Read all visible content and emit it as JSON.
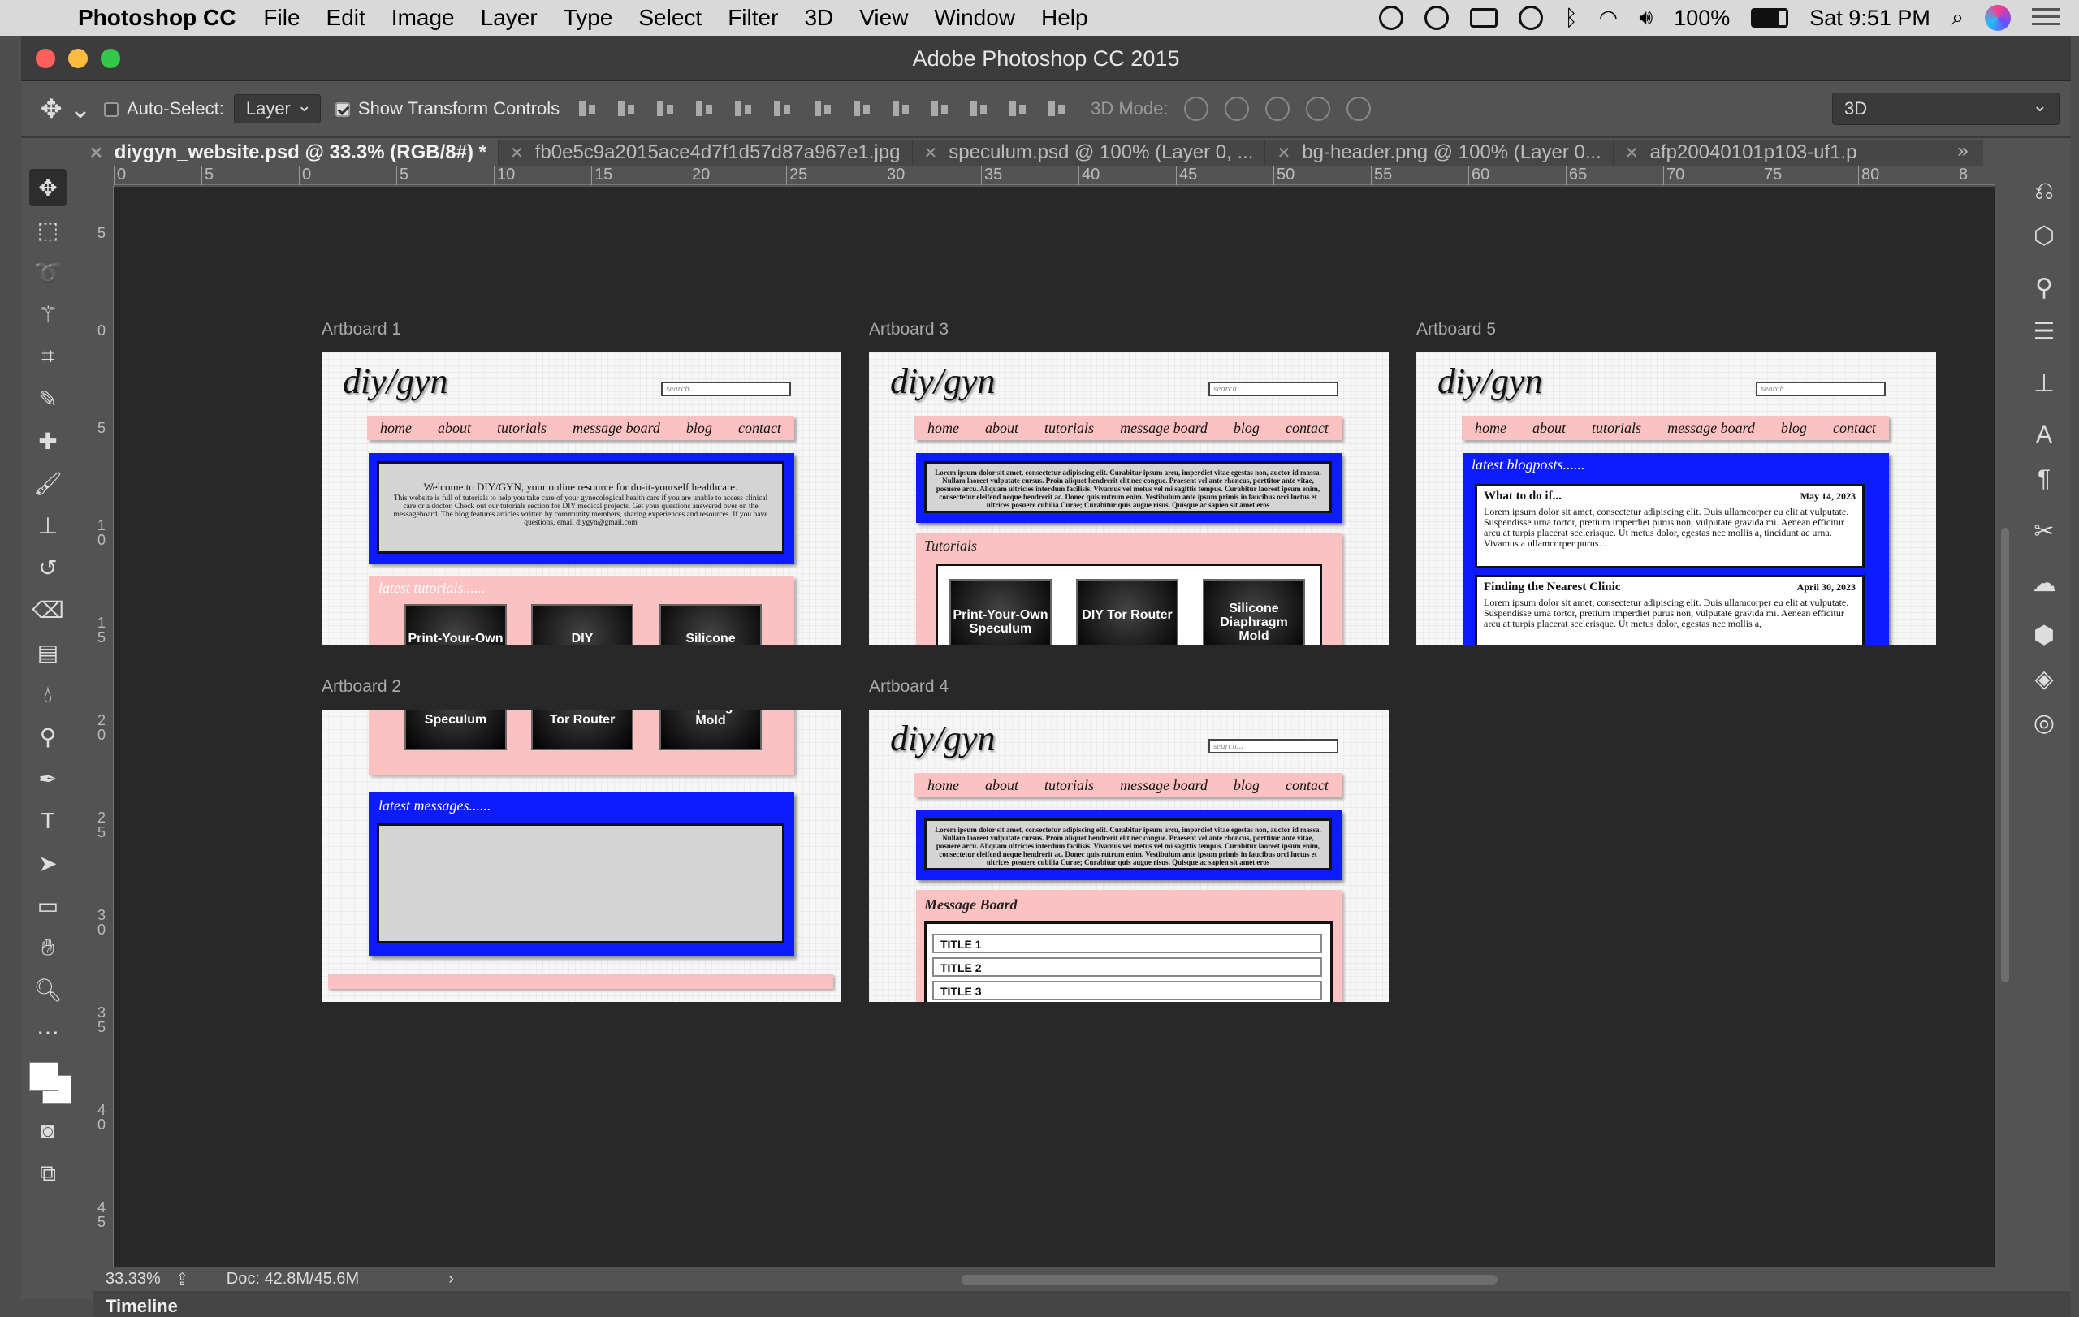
{
  "menubar": {
    "app": "Photoshop CC",
    "items": [
      "File",
      "Edit",
      "Image",
      "Layer",
      "Type",
      "Select",
      "Filter",
      "3D",
      "View",
      "Window",
      "Help"
    ],
    "battery": "100%",
    "clock": "Sat 9:51 PM"
  },
  "window": {
    "title": "Adobe Photoshop CC 2015"
  },
  "options": {
    "auto_select_label": "Auto-Select:",
    "auto_select_value": "Layer",
    "transform_label": "Show Transform Controls",
    "mode3d_label": "3D Mode:",
    "workspace": "3D"
  },
  "tabs": [
    {
      "label": "diygyn_website.psd @ 33.3% (RGB/8#) *"
    },
    {
      "label": "fb0e5c9a2015ace4d7f1d57d87a967e1.jpg"
    },
    {
      "label": "speculum.psd @ 100% (Layer 0, ..."
    },
    {
      "label": "bg-header.png @ 100% (Layer 0..."
    },
    {
      "label": "afp20040101p103-uf1.p"
    }
  ],
  "ruler_h": [
    "0",
    "5",
    "0",
    "5",
    "10",
    "15",
    "20",
    "25",
    "30",
    "35",
    "40",
    "45",
    "50",
    "55",
    "60",
    "65",
    "70",
    "75",
    "80",
    "8"
  ],
  "ruler_v": [
    "5",
    "0",
    "5",
    "10",
    "15",
    "20",
    "25",
    "30",
    "35",
    "40",
    "45"
  ],
  "status": {
    "zoom": "33.33%",
    "doc": "Doc: 42.8M/45.6M"
  },
  "timeline": "Timeline",
  "site": {
    "logo": "diy/gyn",
    "search": "search...",
    "nav": [
      "home",
      "about",
      "tutorials",
      "message board",
      "blog",
      "contact"
    ],
    "welcome_line1": "Welcome to DIY/GYN, your online resource for do-it-yourself healthcare.",
    "welcome_body": "This website is full of tutorials to help you take care of your gynecological health care if you are unable to access clinical care or a doctor. Check out our tutorials section for DIY medical projects. Get your questions answered over on the messageboard. The blog features articles written by community members, sharing experiences and resources. If you have questions, email diygyn@gmail.com",
    "latest_tutorials": "latest tutorials......",
    "tutorials_title": "Tutorials",
    "tutorial1": "Print-Your-Own Speculum",
    "tutorial2": "DIY Tor Router",
    "tutorial3": "Silicone Diaphragm Mold",
    "t1_top": "Print-Your-Own",
    "t2_top": "DIY",
    "t3_top": "Silicone",
    "t1_bottom": "Speculum",
    "t2_bottom": "Tor Router",
    "t3_bottom": "Diaphragm Mold",
    "lorem_block": "Lorem ipsum dolor sit amet, consectetur adipiscing elit. Curabitur ipsum arcu, imperdiet vitae egestas non, auctor id massa. Nullam laoreet vulputate cursus. Proin aliquet hendrerit elit nec congue. Praesent vel ante rhoncus, porttitor ante vitae, posuere arcu. Aliquam ultricies interdum facilisis. Vivamus vel metus vel mi sagittis tempus. Curabitur laoreet ipsum enim, consectetur eleifend neque hendrerit ac. Donec quis rutrum enim. Vestibulum ante ipsum primis in faucibus orci luctus et ultrices posuere cubilia Curae; Curabitur quis augue risus. Quisque ac sapien sit amet eros",
    "latest_blogposts": "latest blogposts......",
    "post1_title": "What to do if...",
    "post1_date": "May 14, 2023",
    "post1_body": "Lorem ipsum dolor sit amet, consectetur adipiscing elit. Duis ullamcorper eu elit at vulputate. Suspendisse urna tortor, pretium imperdiet purus non, vulputate gravida mi. Aenean efficitur arcu at turpis placerat scelerisque. Ut metus dolor, egestas nec mollis a, tincidunt ac urna. Vivamus a ullamcorper purus...",
    "post2_title": "Finding the Nearest Clinic",
    "post2_date": "April 30, 2023",
    "post2_body": "Lorem ipsum dolor sit amet, consectetur adipiscing elit. Duis ullamcorper eu elit at vulputate. Suspendisse urna tortor, pretium imperdiet purus non, vulputate gravida mi. Aenean efficitur arcu at turpis placerat scelerisque. Ut metus dolor, egestas nec mollis a,",
    "latest_messages": "latest messages......",
    "message_board": "Message Board",
    "titles": [
      "TITLE 1",
      "TITLE 2",
      "TITLE 3"
    ]
  },
  "artboards": {
    "a1": "Artboard 1",
    "a2": "Artboard 2",
    "a3": "Artboard 3",
    "a4": "Artboard 4",
    "a5": "Artboard 5"
  }
}
